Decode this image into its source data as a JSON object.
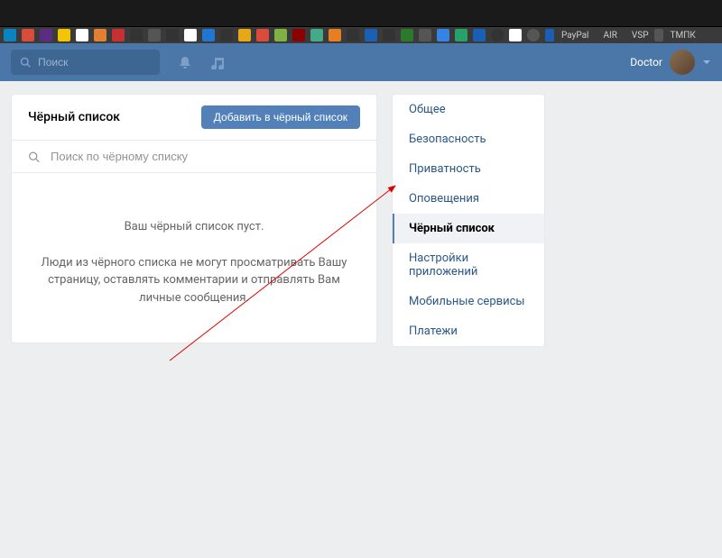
{
  "chrome": {
    "bookmarks_text": [
      "PayPal",
      "AIR",
      "VSP",
      "ТМПК"
    ]
  },
  "header": {
    "search_placeholder": "Поиск",
    "username": "Doctor"
  },
  "main": {
    "title": "Чёрный список",
    "add_button": "Добавить в чёрный список",
    "search_placeholder": "Поиск по чёрному списку",
    "empty_title": "Ваш чёрный список пуст.",
    "empty_description": "Люди из чёрного списка не могут просматривать Вашу страницу, оставлять комментарии и отправлять Вам личные сообщения."
  },
  "sidebar": {
    "items": [
      {
        "label": "Общее"
      },
      {
        "label": "Безопасность"
      },
      {
        "label": "Приватность"
      },
      {
        "label": "Оповещения"
      },
      {
        "label": "Чёрный список"
      },
      {
        "label": "Настройки приложений"
      },
      {
        "label": "Мобильные сервисы"
      },
      {
        "label": "Платежи"
      }
    ],
    "active_index": 4
  }
}
